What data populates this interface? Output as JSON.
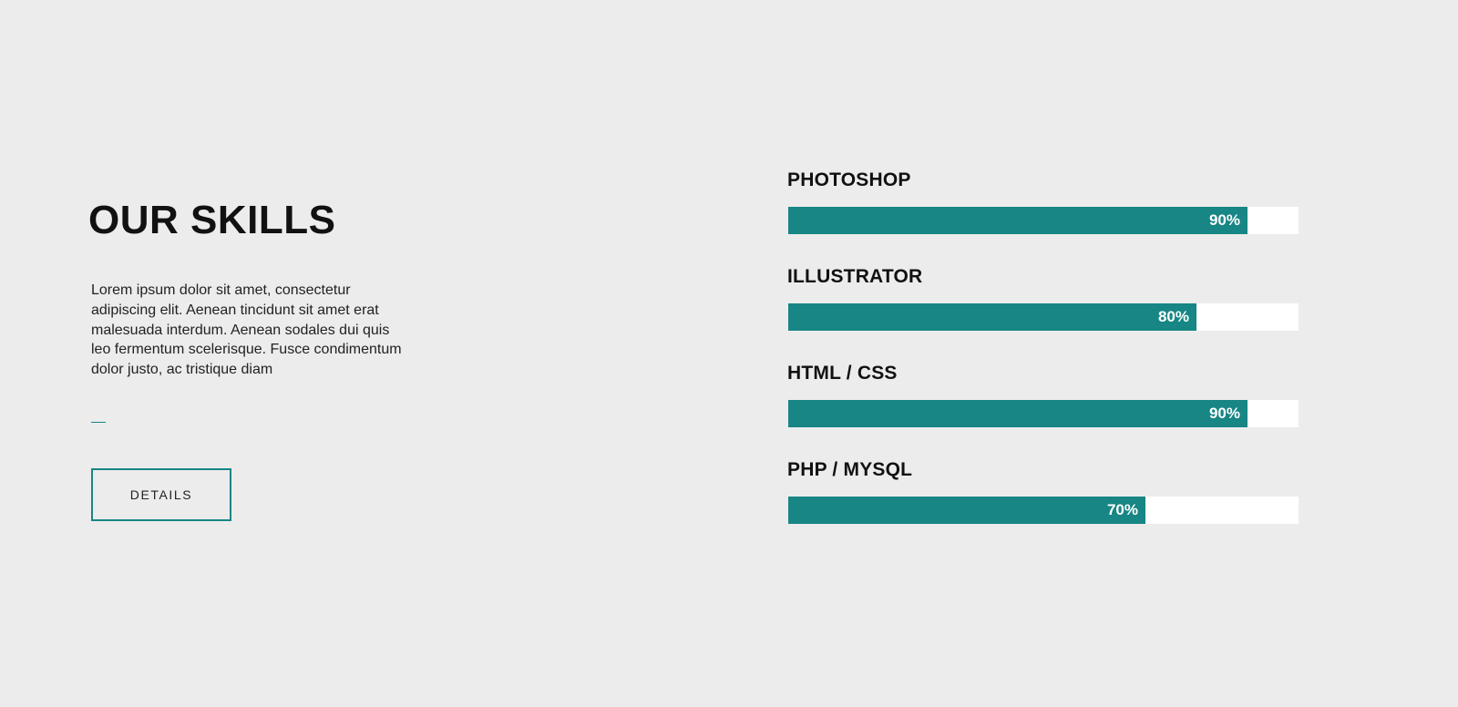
{
  "section": {
    "title": "OUR SKILLS",
    "description": "Lorem ipsum dolor sit amet, consectetur adipiscing elit. Aenean tincidunt sit amet erat malesuada interdum. Aenean sodales dui quis leo fermentum scelerisque. Fusce condimentum dolor justo, ac tristique diam",
    "button_label": "DETAILS"
  },
  "skills": [
    {
      "name": "PHOTOSHOP",
      "percent_label": "90%",
      "level": 0.9
    },
    {
      "name": "ILLUSTRATOR",
      "percent_label": "80%",
      "level": 0.8
    },
    {
      "name": "HTML / CSS",
      "percent_label": "90%",
      "level": 0.9
    },
    {
      "name": "PHP / MYSQL",
      "percent_label": "70%",
      "level": 0.7
    }
  ],
  "colors": {
    "background": "#ececec",
    "accent": "#178684",
    "bar_track": "#ffffff",
    "text": "#111111"
  }
}
